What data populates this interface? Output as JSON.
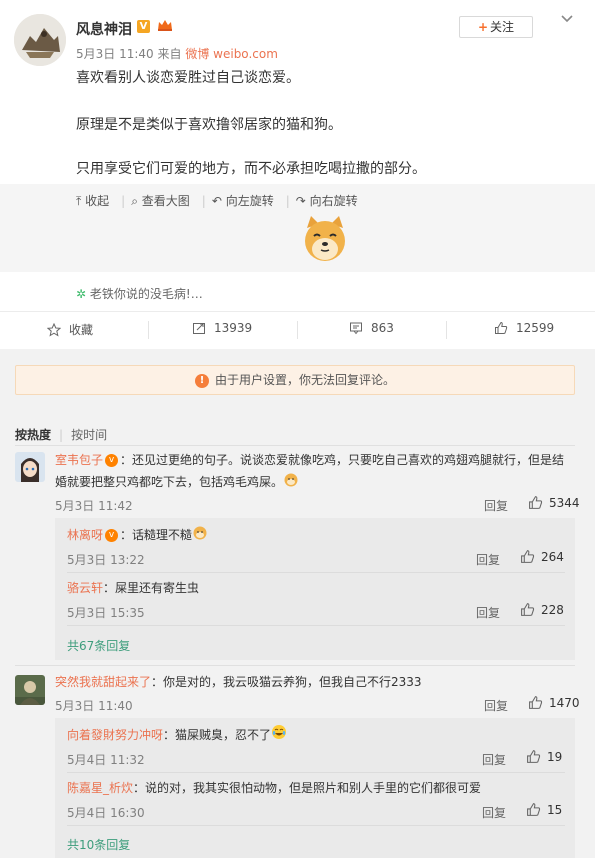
{
  "post": {
    "author": "风息神泪",
    "verified_badge": "V",
    "date": "5月3日 11:40",
    "source_prefix": "来自",
    "source": "微博 weibo.com",
    "follow_label": "关注",
    "lines": [
      "喜欢看别人谈恋爱胜过自己谈恋爱。",
      "原理是不是类似于喜欢撸邻居家的猫和狗。",
      "只用享受它们可爱的地方，而不必承担吃喝拉撒的部分。"
    ]
  },
  "media_tools": {
    "collapse": "收起",
    "view_large": "查看大图",
    "rotate_left": "向左旋转",
    "rotate_right": "向右旋转"
  },
  "bubble": {
    "text": "老铁你说的没毛病!…"
  },
  "actions": {
    "favorite": "收藏",
    "repost_count": "13939",
    "comment_count": "863",
    "like_count": "12599"
  },
  "notice": {
    "text": "由于用户设置，你无法回复评论。"
  },
  "sort": {
    "hot": "按热度",
    "time": "按时间"
  },
  "reply_label": "回复",
  "comments": [
    {
      "name": "室韦包子",
      "text_l1": "还见过更绝的句子。说谈恋爱就像吃鸡，只要吃自己喜欢的鸡翅鸡腿就行，但是结",
      "text_l2": "婚就要把整只鸡都吃下去，包括鸡毛鸡屎。",
      "time": "5月3日 11:42",
      "likes": "5344",
      "replies": [
        {
          "name": "林离呀",
          "text": "话糙理不糙",
          "time": "5月3日 13:22",
          "likes": "264"
        },
        {
          "name": "骆云轩",
          "text": "屎里还有寄生虫",
          "time": "5月3日 15:35",
          "likes": "228"
        }
      ],
      "more": "共67条回复"
    },
    {
      "name": "突然我就甜起来了",
      "text_l1": "你是对的，我云吸猫云养狗，但我自己不行2333",
      "time": "5月3日 11:40",
      "likes": "1470",
      "replies": [
        {
          "name": "向着發財努力冲呀",
          "text": "猫屎贼臭，忍不了",
          "time": "5月4日 11:32",
          "likes": "19"
        },
        {
          "name": "陈嘉星_析炊",
          "text": "说的对，我其实很怕动物，但是照片和别人手里的它们都很可爱",
          "time": "5月4日 16:30",
          "likes": "15"
        }
      ],
      "more": "共10条回复"
    }
  ],
  "colors": {
    "accent_orange": "#eb7350",
    "more_green": "#3d9d7c",
    "notice_bg": "#fdf1e5"
  }
}
